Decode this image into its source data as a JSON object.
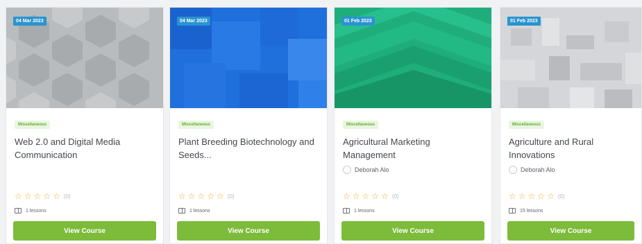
{
  "courses": [
    {
      "date": "04 Mar 2023",
      "category": "Miscellaneous",
      "title": "Web 2.0 and Digital Media Communication",
      "instructor": "",
      "rating_count": "(0)",
      "lessons": "1 lessons",
      "button": "View Course",
      "thumb_color": "#b9bcbe"
    },
    {
      "date": "04 Mar 2023",
      "category": "Miscellaneous",
      "title": "Plant Breeding Biotechnology and Seeds...",
      "instructor": "",
      "rating_count": "(0)",
      "lessons": "1 lessons",
      "button": "View Course",
      "thumb_color": "#1f6fdc"
    },
    {
      "date": "01 Feb 2023",
      "category": "Miscellaneous",
      "title": "Agricultural Marketing Management",
      "instructor": "Deborah Alo",
      "rating_count": "(0)",
      "lessons": "1 lessons",
      "button": "View Course",
      "thumb_color": "#1fae7b"
    },
    {
      "date": "01 Feb 2023",
      "category": "Miscellaneous",
      "title": "Agriculture and Rural Innovations",
      "instructor": "Deborah Alo",
      "rating_count": "(0)",
      "lessons": "15 lessons",
      "button": "View Course",
      "thumb_color": "#d4d6d9"
    }
  ],
  "colors": {
    "accent_green": "#7dbb3a",
    "date_badge": "#2a94d0",
    "star": "#f2a922",
    "category_bg": "#e9f6df",
    "category_text": "#6aab35"
  },
  "icons": {
    "star": "star-outline-icon",
    "lessons": "book-icon",
    "instructor": "avatar-icon"
  }
}
